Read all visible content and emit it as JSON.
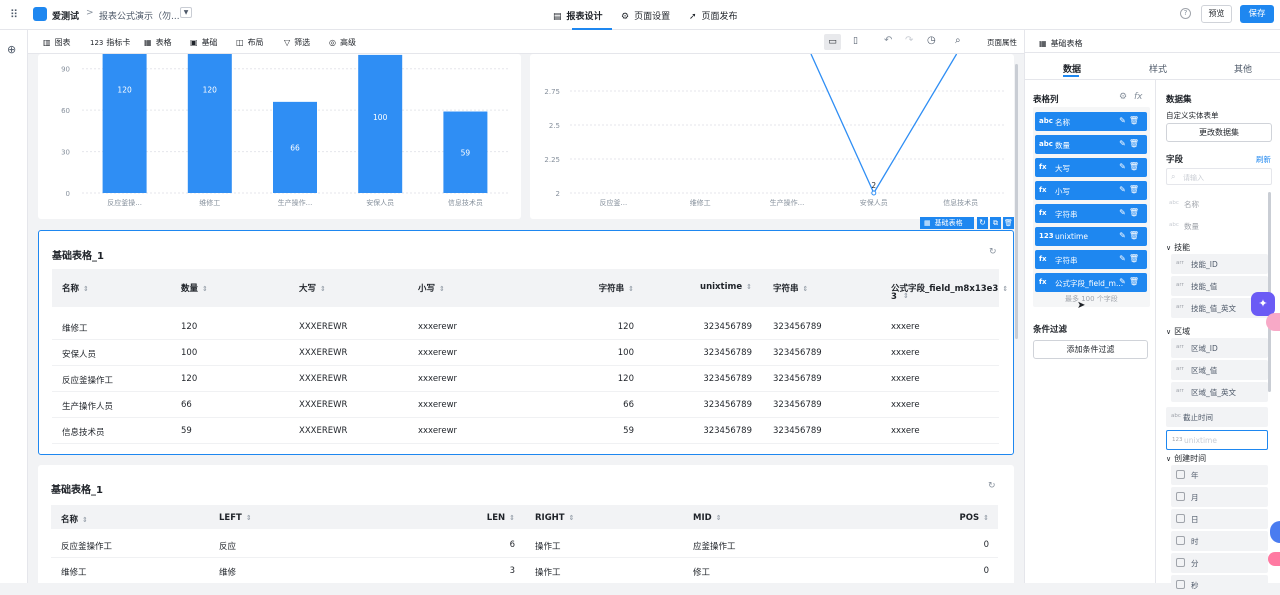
{
  "header": {
    "app_name": "爱测试",
    "page_name": "报表公式演示（勿...",
    "center_tabs": [
      "报表设计",
      "页面设置",
      "页面发布"
    ],
    "preview_label": "预览",
    "save_label": "保存"
  },
  "toolbar": {
    "items": [
      "图表",
      "指标卡",
      "表格",
      "基础",
      "布局",
      "筛选",
      "高级"
    ],
    "page_props_label": "页面属性"
  },
  "bar_chart": {
    "chart_data": {
      "type": "bar",
      "categories": [
        "反应釜操...",
        "维修工",
        "生产操作...",
        "安保人员",
        "信息技术员"
      ],
      "values": [
        120,
        120,
        66,
        100,
        59
      ],
      "yticks": [
        "0",
        "30",
        "60",
        "90"
      ],
      "ylim": [
        0,
        105
      ],
      "color": "#2f8ef4"
    }
  },
  "line_chart": {
    "chart_data": {
      "type": "line",
      "categories": [
        "反应釜...",
        "维修工",
        "生产操作...",
        "安保人员",
        "信息技术员"
      ],
      "yticks": [
        "2",
        "2.25",
        "2.5",
        "2.75"
      ],
      "visible_point_label": "2",
      "color": "#2f8ef4"
    }
  },
  "selection_bar": {
    "label": "基础表格"
  },
  "table1": {
    "title": "基础表格_1",
    "columns": [
      "名称",
      "数量",
      "大写",
      "小写",
      "字符串",
      "unixtime",
      "字符串",
      "公式字段_field_m8x13e3",
      "3"
    ],
    "rows": [
      [
        "维修工",
        "120",
        "XXXEREWR",
        "xxxerewr",
        "120",
        "323456789",
        "323456789",
        "xxxere"
      ],
      [
        "安保人员",
        "100",
        "XXXEREWR",
        "xxxerewr",
        "100",
        "323456789",
        "323456789",
        "xxxere"
      ],
      [
        "反应釜操作工",
        "120",
        "XXXEREWR",
        "xxxerewr",
        "120",
        "323456789",
        "323456789",
        "xxxere"
      ],
      [
        "生产操作人员",
        "66",
        "XXXEREWR",
        "xxxerewr",
        "66",
        "323456789",
        "323456789",
        "xxxere"
      ],
      [
        "信息技术员",
        "59",
        "XXXEREWR",
        "xxxerewr",
        "59",
        "323456789",
        "323456789",
        "xxxere"
      ]
    ]
  },
  "table2": {
    "title": "基础表格_1",
    "columns": [
      "名称",
      "LEFT",
      "LEN",
      "RIGHT",
      "MID",
      "POS"
    ],
    "rows": [
      [
        "反应釜操作工",
        "反应",
        "6",
        "操作工",
        "应釜操作工",
        "0"
      ],
      [
        "维修工",
        "维修",
        "3",
        "操作工",
        "修工",
        "0"
      ]
    ]
  },
  "props": {
    "title": "基础表格",
    "tabs": [
      "数据",
      "样式",
      "其他"
    ],
    "table_columns_label": "表格列",
    "columns": [
      {
        "type": "abc",
        "name": "名称"
      },
      {
        "type": "abc",
        "name": "数量"
      },
      {
        "type": "fx",
        "name": "大写"
      },
      {
        "type": "fx",
        "name": "小写"
      },
      {
        "type": "fx",
        "name": "字符串"
      },
      {
        "type": "123",
        "name": "unixtime"
      },
      {
        "type": "fx",
        "name": "字符串"
      },
      {
        "type": "fx",
        "name": "公式字段_field_m..."
      }
    ],
    "max_fields_hint": "最多 100 个字段",
    "condition_filter_label": "条件过滤",
    "add_filter_label": "添加条件过滤",
    "dataset_label": "数据集",
    "dataset_name": "自定义实体表单",
    "change_dataset_label": "更改数据集",
    "fields_label": "字段",
    "refresh_label": "刷新",
    "search_placeholder": "请输入",
    "top_fields": [
      {
        "type": "abc",
        "name": "名称"
      },
      {
        "type": "abc",
        "name": "数量"
      }
    ],
    "groups": [
      {
        "name": "技能",
        "fields": [
          "技能_ID",
          "技能_值",
          "技能_值_英文"
        ]
      },
      {
        "name": "区域",
        "fields": [
          "区域_ID",
          "区域_值",
          "区域_值_英文"
        ]
      }
    ],
    "cutoff_field": {
      "type": "abc",
      "name": "截止时间"
    },
    "unixtime_field": {
      "type": "123",
      "name": "unixtime"
    },
    "created_group": {
      "name": "创建时间",
      "fields": [
        "年",
        "月",
        "日",
        "时",
        "分",
        "秒"
      ]
    },
    "field_type_arr": "arr"
  }
}
